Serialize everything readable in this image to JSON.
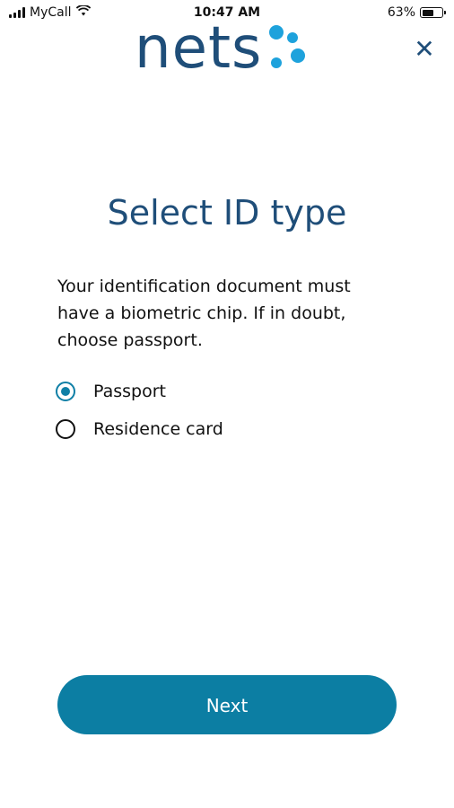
{
  "status_bar": {
    "carrier": "MyCall",
    "time": "10:47 AM",
    "battery": "63%",
    "battery_level": 0.63,
    "icons": [
      "signal-icon",
      "wifi-icon",
      "battery-icon"
    ]
  },
  "header": {
    "logo_text": "nets",
    "close_icon": "close-icon",
    "close_glyph": "✕"
  },
  "colors": {
    "brand_navy": "#1f4e79",
    "brand_dots": "#1ea2dc",
    "accent": "#0c7ea3"
  },
  "main": {
    "title": "Select ID type",
    "instructions": "Your identification document must have a biometric chip. If in doubt, choose passport.",
    "options": [
      {
        "label": "Passport",
        "selected": true
      },
      {
        "label": "Residence card",
        "selected": false
      }
    ],
    "next_label": "Next"
  }
}
